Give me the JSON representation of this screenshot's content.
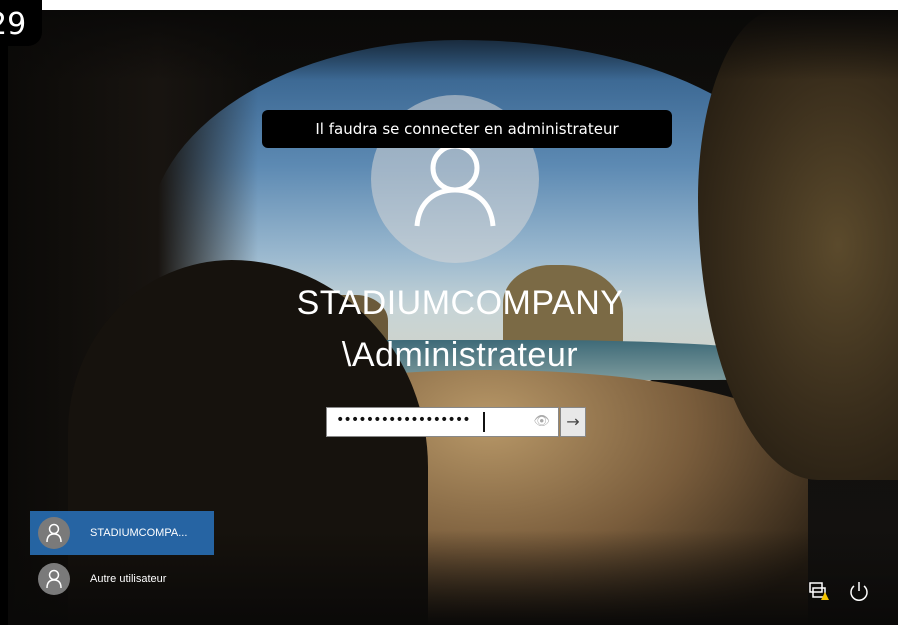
{
  "corner_badge": "29",
  "tooltip": "Il faudra se connecter en administrateur",
  "account": {
    "name_line1": "STADIUMCOMPANY",
    "name_line2": "\\Administrateur"
  },
  "password": {
    "masked_value": "••••••••••••••••••",
    "reveal_icon": "eye-icon",
    "submit_icon": "arrow-right-icon"
  },
  "user_list": [
    {
      "label": "STADIUMCOMPA...",
      "selected": true
    },
    {
      "label": "Autre utilisateur",
      "selected": false
    }
  ],
  "tray": {
    "network_icon": "network-warning-icon",
    "power_icon": "power-icon"
  },
  "colors": {
    "selection": "#286EB4",
    "tooltip_bg": "#000000",
    "warning": "#F2C200"
  }
}
